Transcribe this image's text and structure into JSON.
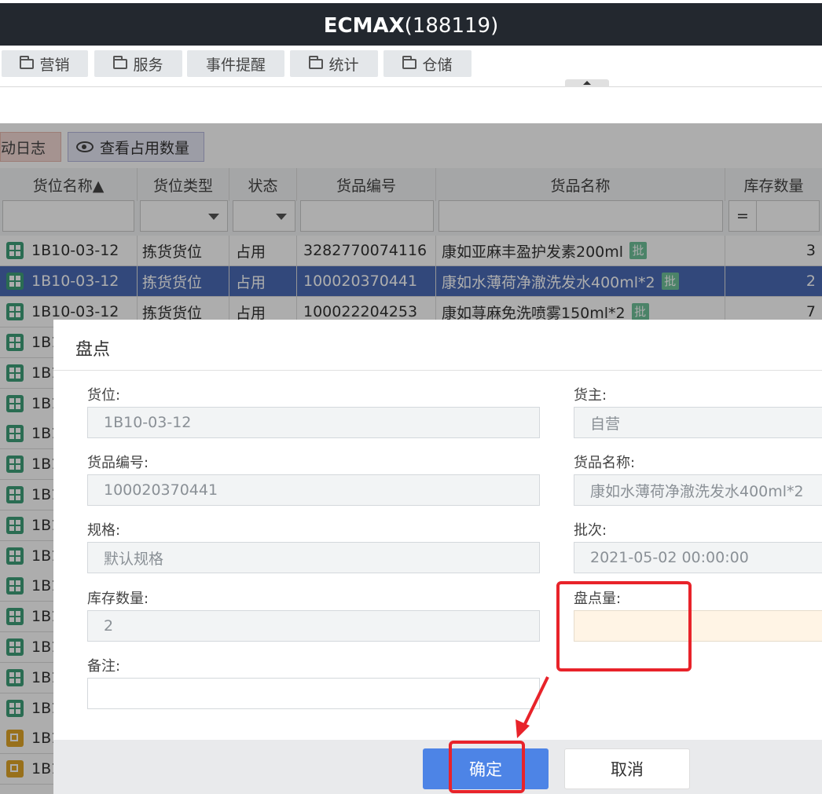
{
  "app": {
    "title_bold": "ECMAX",
    "title_rest": "(188119)"
  },
  "menu": [
    {
      "label": "营销",
      "icon": "folder-icon"
    },
    {
      "label": "服务",
      "icon": "folder-icon"
    },
    {
      "label": "事件提醒",
      "icon": ""
    },
    {
      "label": "统计",
      "icon": "folder-icon"
    },
    {
      "label": "仓储",
      "icon": "folder-icon"
    }
  ],
  "toolbar": {
    "log_label": "变动日志",
    "view_occupied_label": "查看占用数量"
  },
  "grid": {
    "columns": [
      "货位名称▲",
      "货位类型",
      "状态",
      "货品编号",
      "货品名称",
      "库存数量"
    ],
    "filter_eq": "=",
    "batch_badge": "批",
    "rows": [
      {
        "location": "1B10-03-12",
        "type": "拣货货位",
        "status": "占用",
        "code": "3282770074116",
        "name": "康如亚麻丰盈护发素200ml",
        "qty": "3"
      },
      {
        "location": "1B10-03-12",
        "type": "拣货货位",
        "status": "占用",
        "code": "100020370441",
        "name": "康如水薄荷净澈洗发水400ml*2",
        "qty": "2"
      },
      {
        "location": "1B10-03-12",
        "type": "拣货货位",
        "status": "占用",
        "code": "100022204253",
        "name": "康如荨麻免洗喷雾150ml*2",
        "qty": "7"
      }
    ],
    "truncated_rows": [
      "1B1",
      "1B1",
      "1B1",
      "1B1",
      "1B1",
      "1B1",
      "1B1",
      "1B1",
      "1B1",
      "1B1",
      "1B1",
      "1B1",
      "1B1",
      "1B1",
      "1B1"
    ]
  },
  "dialog": {
    "title": "盘点",
    "fields": {
      "location": {
        "label": "货位:",
        "value": "1B10-03-12"
      },
      "owner": {
        "label": "货主:",
        "value": "自营"
      },
      "item_code": {
        "label": "货品编号:",
        "value": "100020370441"
      },
      "item_name": {
        "label": "货品名称:",
        "value": "康如水薄荷净澈洗发水400ml*2"
      },
      "spec": {
        "label": "规格:",
        "value": "默认规格"
      },
      "batch": {
        "label": "批次:",
        "value": "2021-05-02 00:00:00"
      },
      "stock_qty": {
        "label": "库存数量:",
        "value": "2"
      },
      "count_qty": {
        "label": "盘点量:",
        "value": ""
      },
      "remark": {
        "label": "备注:",
        "value": ""
      }
    },
    "ok_label": "确定",
    "cancel_label": "取消"
  },
  "colors": {
    "topbar": "#23282f",
    "selected_row": "#4a6bb5",
    "primary_button": "#4d84e6",
    "annotation": "#e8232a"
  }
}
